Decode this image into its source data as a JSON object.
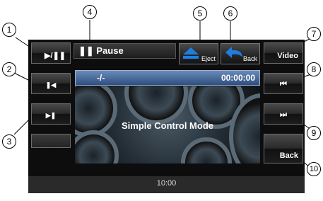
{
  "left_buttons": [
    {
      "label": "▶/❚❚",
      "icon": "play-pause-icon"
    },
    {
      "label": "❚◀",
      "icon": "skip-back-icon"
    },
    {
      "label": "▶❚",
      "icon": "skip-forward-icon"
    },
    {
      "label": "",
      "icon": ""
    }
  ],
  "right_buttons": [
    {
      "label": "Video"
    },
    {
      "label": "⏮",
      "icon": "fast-back-icon"
    },
    {
      "label": "⏭",
      "icon": "fast-forward-icon"
    },
    {
      "label": "Back"
    }
  ],
  "status": {
    "label": "❚❚ Pause"
  },
  "top_buttons": {
    "eject_label": "Eject",
    "back_label": "Back"
  },
  "track": {
    "name": "-/-",
    "time": "00:00:00"
  },
  "main": {
    "mode_label": "Simple Control Mode"
  },
  "clock": "10:00",
  "callouts": [
    "1",
    "2",
    "3",
    "4",
    "5",
    "6",
    "7",
    "8",
    "9",
    "10"
  ],
  "colors": {
    "screen": "#0d0d0d",
    "track_bar": "#4b6a9c",
    "eject_icon": "#1e7fe0"
  }
}
